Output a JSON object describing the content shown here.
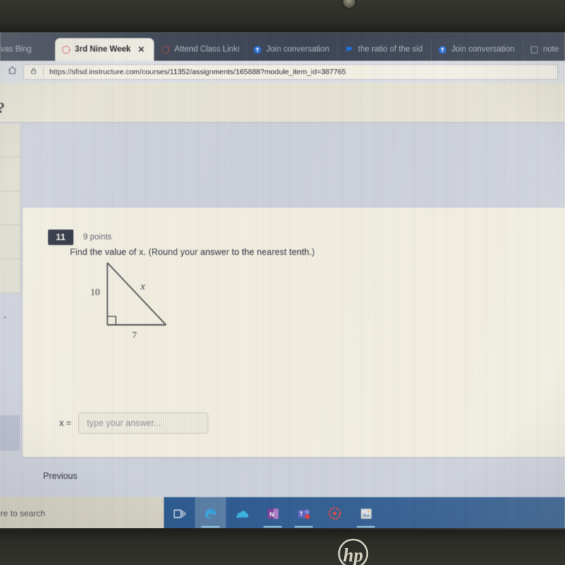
{
  "device": {
    "brand": "hp",
    "brand_label": "hp"
  },
  "browser": {
    "tabs": [
      {
        "label": "canvas  Bing",
        "favicon": "none-icon",
        "active": false
      },
      {
        "label": "3rd Nine Week",
        "favicon": "canvas-icon",
        "active": true,
        "close_label": "✕"
      },
      {
        "label": "Attend Class Links",
        "favicon": "canvas-icon",
        "active": false
      },
      {
        "label": "Join conversation",
        "favicon": "teams-icon",
        "active": false
      },
      {
        "label": "the ratio of the sid",
        "favicon": "brainly-icon",
        "active": false
      },
      {
        "label": "Join conversation",
        "favicon": "teams-icon",
        "active": false
      },
      {
        "label": "note",
        "favicon": "onenote-icon",
        "active": false
      }
    ],
    "toolbar": {
      "home_icon": "home-icon",
      "lock_icon": "lock-icon",
      "url": "https://sfisd.instructure.com/courses/11352/assignments/165888?module_item_id=387765"
    }
  },
  "page": {
    "help_glyph": "?",
    "question": {
      "number": "11",
      "points": "9 points",
      "prompt": "Find the value of x. (Round your answer to the nearest tenth.)",
      "answer_label": "x =",
      "answer_value": "",
      "answer_placeholder": "type your answer...",
      "previous_label": "Previous"
    },
    "figure": {
      "type": "right-triangle",
      "vertical_leg_label": "10",
      "horizontal_leg_label": "7",
      "hypotenuse_label": "x",
      "right_angle_marker": true
    }
  },
  "taskbar": {
    "search_text": "ere to search",
    "icons": [
      {
        "name": "task-view-icon",
        "selected": false,
        "underline": false
      },
      {
        "name": "edge-browser-icon",
        "selected": true,
        "underline": true
      },
      {
        "name": "onedrive-icon",
        "selected": false,
        "underline": false
      },
      {
        "name": "onenote-icon",
        "selected": false,
        "underline": true
      },
      {
        "name": "teams-icon",
        "selected": false,
        "underline": true
      },
      {
        "name": "canvas-icon",
        "selected": false,
        "underline": false
      },
      {
        "name": "photos-icon",
        "selected": false,
        "underline": true
      }
    ]
  },
  "colors": {
    "tabstrip": "#3c4557",
    "taskbar": "#2c5b94",
    "question_badge": "#2b3141",
    "page_bg": "#cfd4e3"
  }
}
